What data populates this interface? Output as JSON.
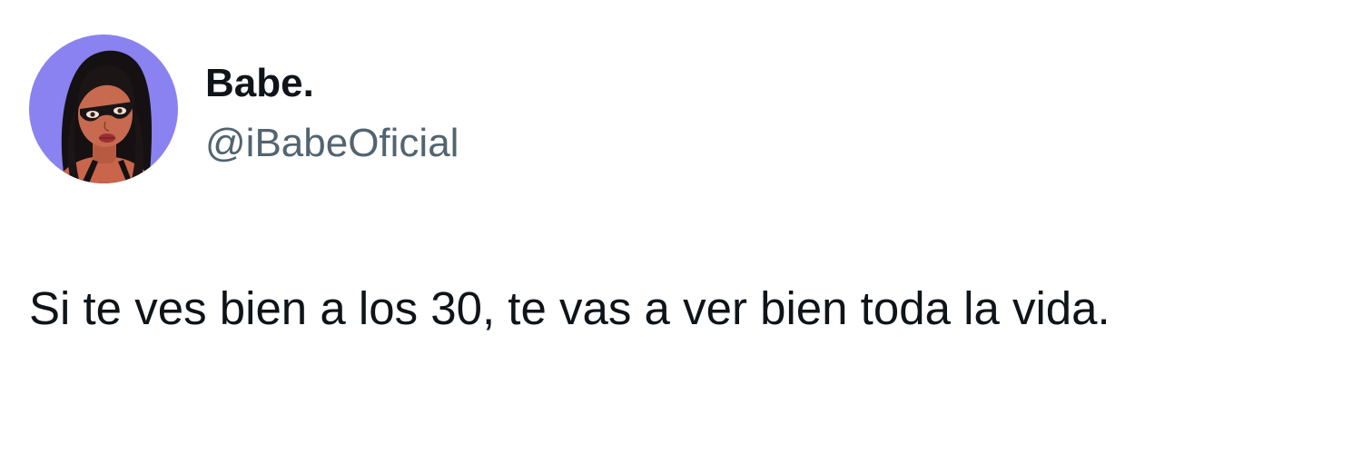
{
  "author": {
    "display_name": "Babe.",
    "handle": "@iBabeOficial",
    "avatar_icon": "cartoon-woman-avatar",
    "avatar_bg": "#8a82f0"
  },
  "tweet": {
    "text": "Si te ves bien a los 30, te vas a ver bien toda la vida."
  },
  "colors": {
    "primary_text": "#0f1419",
    "secondary_text": "#536471",
    "background": "#ffffff"
  }
}
